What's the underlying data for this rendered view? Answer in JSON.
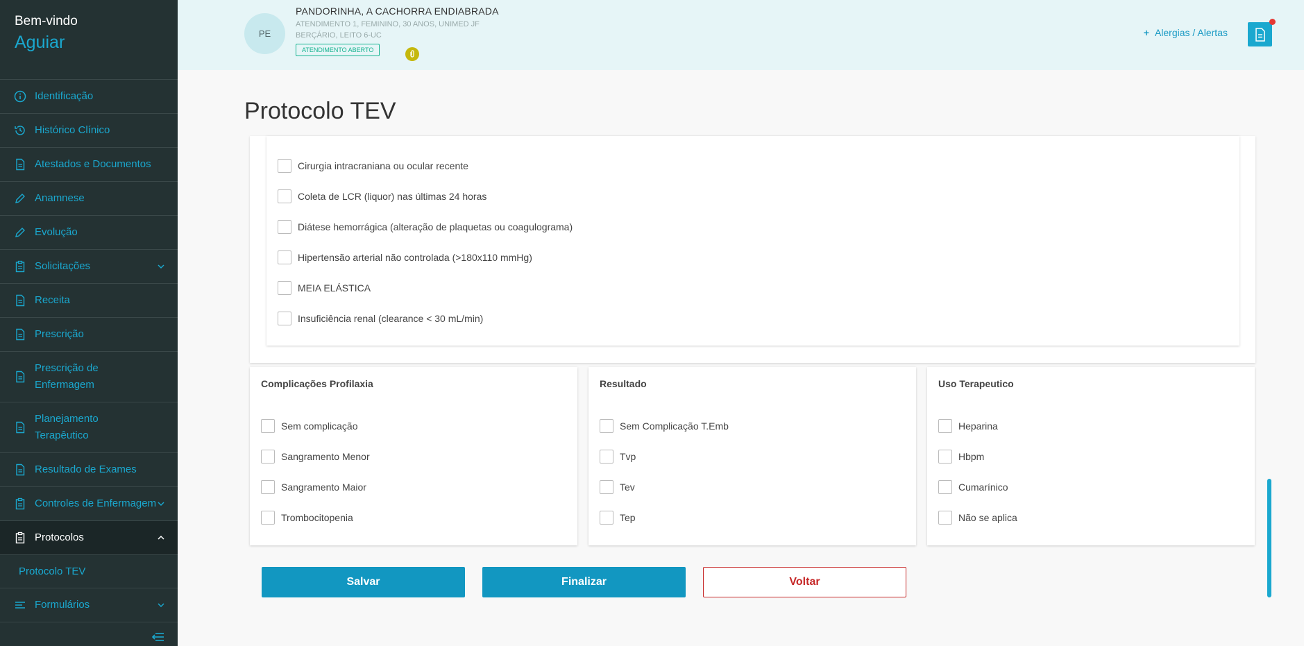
{
  "sidebar": {
    "welcome": "Bem-vindo",
    "user": "Aguiar",
    "items": [
      {
        "label": "Identificação",
        "icon": "info-icon"
      },
      {
        "label": "Histórico Clínico",
        "icon": "history-icon"
      },
      {
        "label": "Atestados e Documentos",
        "icon": "document-icon"
      },
      {
        "label": "Anamnese",
        "icon": "pencil-icon"
      },
      {
        "label": "Evolução",
        "icon": "pencil-icon"
      },
      {
        "label": "Solicitações",
        "icon": "clipboard-icon"
      },
      {
        "label": "Receita",
        "icon": "document-icon"
      },
      {
        "label": "Prescrição",
        "icon": "document-icon"
      },
      {
        "label": "Prescrição de Enfermagem",
        "icon": "document-icon"
      },
      {
        "label": "Planejamento Terapêutico",
        "icon": "document-icon"
      },
      {
        "label": "Resultado de Exames",
        "icon": "document-icon"
      },
      {
        "label": "Controles de Enfermagem",
        "icon": "clipboard-icon"
      },
      {
        "label": "Protocolos",
        "icon": "clipboard-icon"
      },
      {
        "label": "Formulários",
        "icon": "list-icon"
      }
    ],
    "sub_item": "Protocolo TEV"
  },
  "header": {
    "initials": "PE",
    "patient_name": "PANDORINHA, A CACHORRA ENDIABRADA",
    "line1": "ATENDIMENTO 1, FEMININO, 30 ANOS, UNIMED JF",
    "line2": "BERÇÁRIO, LEITO 6-UC",
    "badge": "ATENDIMENTO ABERTO",
    "alerts": "Alergias / Alertas",
    "alerts_plus": "+"
  },
  "page_title": "Protocolo TEV",
  "contraindications": [
    "Cirurgia intracraniana ou ocular recente",
    "Coleta de LCR (liquor) nas últimas 24 horas",
    "Diátese hemorrágica (alteração de plaquetas ou coagulograma)",
    "Hipertensão arterial não controlada (>180x110 mmHg)",
    "MEIA ELÁSTICA",
    "Insuficiência renal (clearance < 30 mL/min)"
  ],
  "cards": {
    "complicacoes": {
      "title": "Complicações Profilaxia",
      "options": [
        "Sem complicação",
        "Sangramento Menor",
        "Sangramento Maior",
        "Trombocitopenia"
      ]
    },
    "resultado": {
      "title": "Resultado",
      "options": [
        "Sem Complicação T.Emb",
        "Tvp",
        "Tev",
        "Tep"
      ]
    },
    "uso": {
      "title": "Uso Terapeutico",
      "options": [
        "Heparina",
        "Hbpm",
        "Cumarínico",
        "Não se aplica"
      ]
    }
  },
  "buttons": {
    "save": "Salvar",
    "finish": "Finalizar",
    "back": "Voltar"
  },
  "colors": {
    "accent": "#1aa8cf",
    "sidebar_bg": "#243233",
    "header_bg": "#e6f5f7",
    "danger": "#c62828",
    "status_green": "#14b38f"
  }
}
